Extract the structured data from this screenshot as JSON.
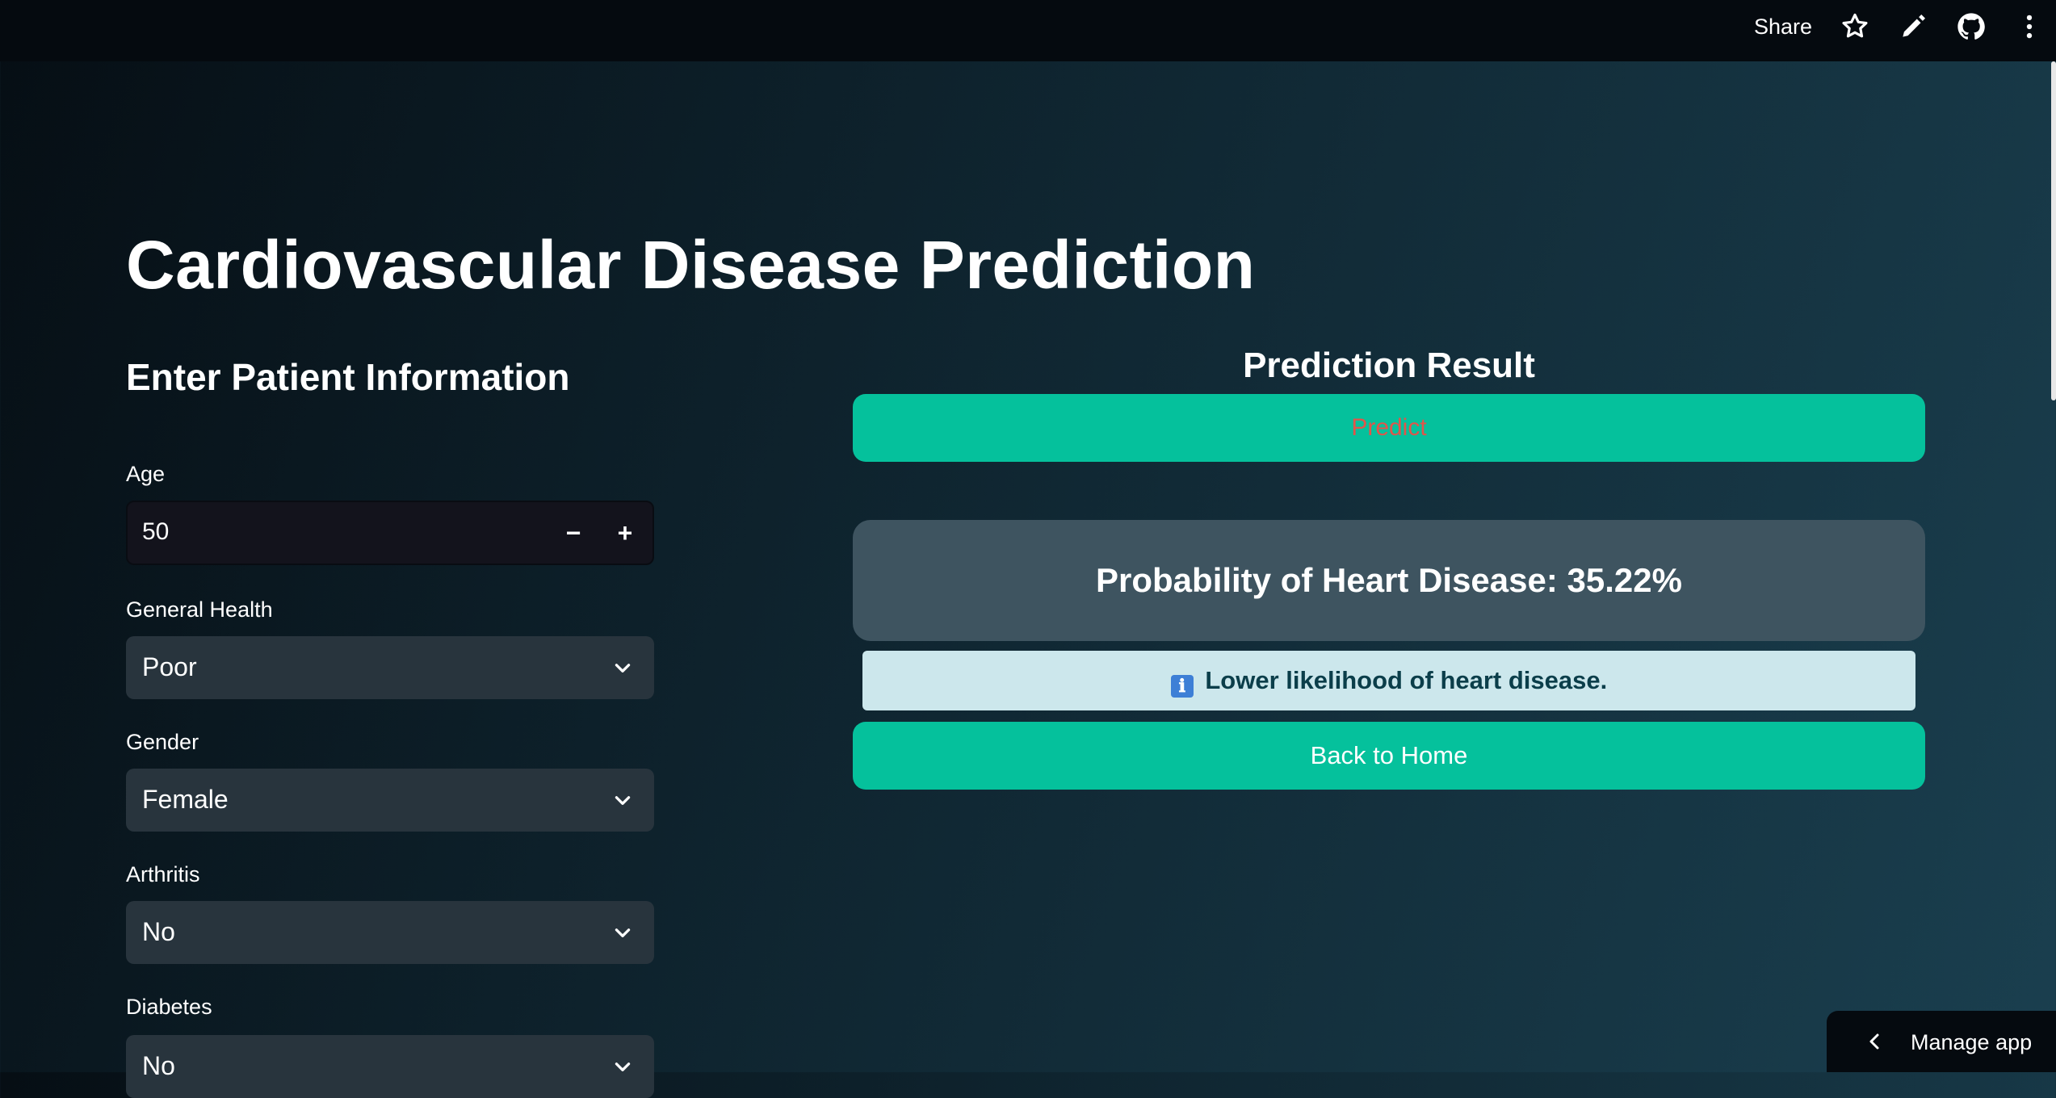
{
  "topbar": {
    "share_label": "Share",
    "icons": [
      "star-icon",
      "pencil-icon",
      "github-icon",
      "more-vertical-icon"
    ]
  },
  "page": {
    "title": "Cardiovascular Disease Prediction"
  },
  "form": {
    "heading": "Enter Patient Information",
    "age": {
      "label": "Age",
      "value": "50",
      "decrement": "−",
      "increment": "+"
    },
    "general_health": {
      "label": "General Health",
      "value": "Poor"
    },
    "gender": {
      "label": "Gender",
      "value": "Female"
    },
    "arthritis": {
      "label": "Arthritis",
      "value": "No"
    },
    "diabetes": {
      "label": "Diabetes",
      "value": "No"
    }
  },
  "result": {
    "heading": "Prediction Result",
    "predict_label": "Predict",
    "probability_text": "Probability of Heart Disease: 35.22%",
    "info_icon": "ℹ",
    "info_text": "Lower likelihood of heart disease.",
    "back_label": "Back to Home"
  },
  "footer": {
    "manage_label": "Manage app"
  },
  "colors": {
    "accent": "#05C19C",
    "info_bg": "#CCE7EC",
    "card_bg": "#3E5460",
    "predict_text": "#E0554A"
  }
}
